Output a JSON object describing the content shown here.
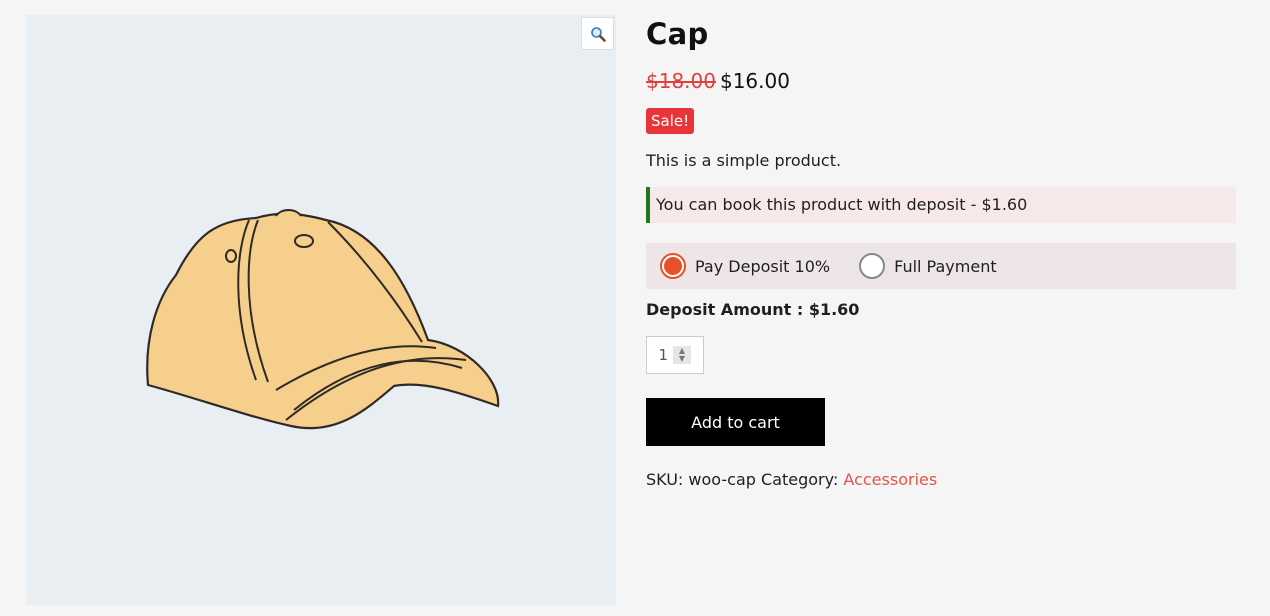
{
  "product": {
    "title": "Cap",
    "price_old": "$18.00",
    "price_new": "$16.00",
    "sale_badge": "Sale!",
    "description": "This is a simple product.",
    "deposit_notice": "You can book this product with deposit - $1.60",
    "options": {
      "deposit_label": "Pay Deposit 10%",
      "full_label": "Full Payment",
      "selected": "deposit"
    },
    "deposit_amount": "Deposit Amount : $1.60",
    "quantity": "1",
    "add_to_cart": "Add to cart",
    "meta": {
      "sku_label": "SKU:",
      "sku": "woo-cap",
      "category_label": "Category:",
      "category": "Accessories"
    }
  },
  "colors": {
    "accent": "#e8502a",
    "sale": "#e8353a",
    "notice_border": "#1c7a1c"
  },
  "icons": {
    "zoom": "magnifier-icon"
  }
}
